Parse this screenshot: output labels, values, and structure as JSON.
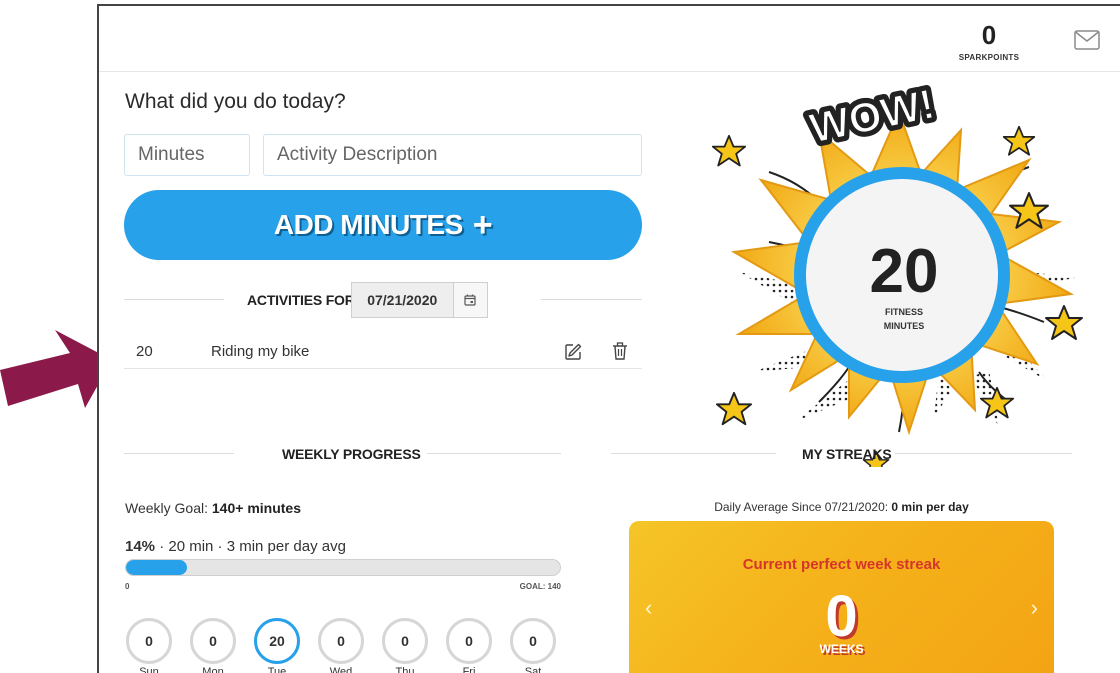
{
  "header": {
    "sparkpoints_value": "0",
    "sparkpoints_label": "SPARKPOINTS",
    "mail_icon": "envelope-icon"
  },
  "log": {
    "heading": "What did you do today?",
    "minutes_placeholder": "Minutes",
    "description_placeholder": "Activity Description",
    "add_button_label": "ADD MINUTES",
    "add_button_icon": "+"
  },
  "activities": {
    "title": "ACTIVITIES FOR",
    "date": "07/21/2020",
    "items": [
      {
        "minutes": "20",
        "description": "Riding my bike"
      }
    ]
  },
  "burst": {
    "wow_text": "WOW!",
    "value": "20",
    "label_line1": "FITNESS",
    "label_line2": "MINUTES",
    "colors": {
      "burst": "#f5b81c",
      "ring": "#27a1e9",
      "star": "#f5c518"
    }
  },
  "weekly": {
    "title": "WEEKLY PROGRESS",
    "goal_prefix": "Weekly Goal: ",
    "goal_value": "140+ minutes",
    "percent": "14%",
    "summary": " · 20 min · 3 min per day avg",
    "progress_fraction": 0.14,
    "start_label": "0",
    "goal_label": "GOAL: 140",
    "days": [
      {
        "label": "Sun",
        "value": "0",
        "active": false
      },
      {
        "label": "Mon",
        "value": "0",
        "active": false
      },
      {
        "label": "Tue",
        "value": "20",
        "active": true
      },
      {
        "label": "Wed",
        "value": "0",
        "active": false
      },
      {
        "label": "Thu",
        "value": "0",
        "active": false
      },
      {
        "label": "Fri",
        "value": "0",
        "active": false
      },
      {
        "label": "Sat",
        "value": "0",
        "active": false
      }
    ]
  },
  "streaks": {
    "title": "MY STREAKS",
    "daily_avg_prefix": "Daily Average Since 07/21/2020: ",
    "daily_avg_value": "0 min per day",
    "card_title": "Current perfect week streak",
    "card_value": "0",
    "card_unit": "WEEKS",
    "prev_icon": "‹",
    "next_icon": "›"
  },
  "colors": {
    "accent": "#27a1e9",
    "annotation_arrow": "#8b1a4a",
    "streak_title": "#d6362a"
  }
}
